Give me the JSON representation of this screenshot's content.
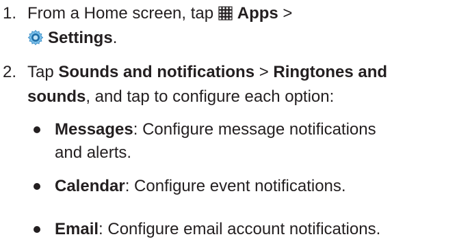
{
  "steps": [
    {
      "number": "1.",
      "line1": {
        "pre": "From a Home screen, tap ",
        "apps_icon": "apps-grid-icon",
        "apps": "Apps",
        "sep": " >"
      },
      "line2": {
        "settings_icon": "settings-gear-icon",
        "settings": "Settings",
        "post": "."
      }
    },
    {
      "number": "2.",
      "line1": {
        "pre": "Tap ",
        "a": "Sounds and notifications",
        "sep": " > ",
        "b": "Ringtones and"
      },
      "line2": {
        "b": "sounds",
        "post": ", and tap to configure each option:"
      }
    }
  ],
  "bullets": [
    {
      "term": "Messages",
      "desc1": ": Configure message notifications",
      "desc2": "and alerts."
    },
    {
      "term": "Calendar",
      "desc1": ": Configure event notifications."
    },
    {
      "term": "Email",
      "desc1": ": Configure email account notifications."
    }
  ],
  "colors": {
    "text": "#231f20",
    "settings_icon_outer": "#4fa3d9",
    "settings_icon_inner": "#1f6fa8"
  }
}
